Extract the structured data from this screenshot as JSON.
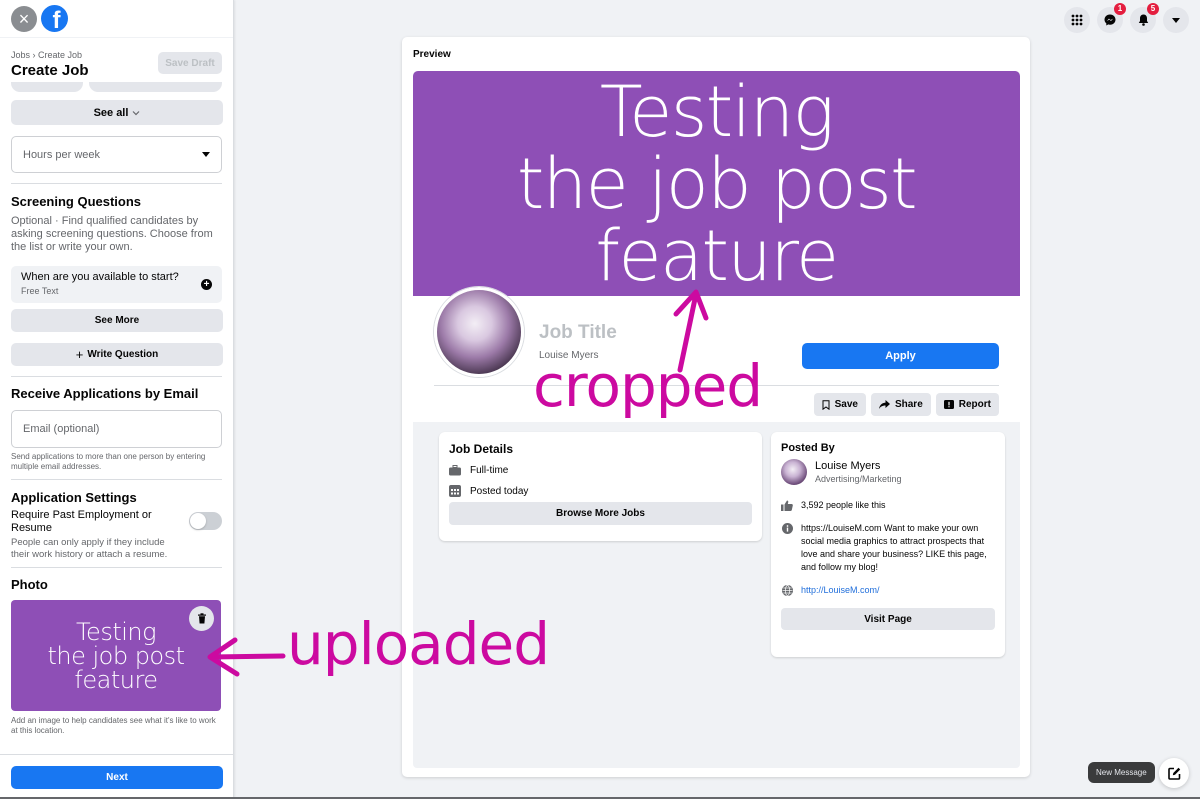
{
  "sidebar": {
    "breadcrumb": "Jobs › Create Job",
    "title": "Create Job",
    "save_draft": "Save Draft",
    "see_all": "See all",
    "hours_select": {
      "placeholder": "Hours per week"
    },
    "screening": {
      "title": "Screening Questions",
      "description": "Optional · Find qualified candidates by asking screening questions. Choose from the list or write your own.",
      "question": {
        "title": "When are you available to start?",
        "type": "Free Text"
      },
      "see_more": "See More",
      "write_question": "Write Question"
    },
    "email_section": {
      "title": "Receive Applications by Email",
      "placeholder": "Email (optional)",
      "helper": "Send applications to more than one person by entering multiple email addresses."
    },
    "app_settings": {
      "title": "Application Settings",
      "require_label": "Require Past Employment or Resume",
      "require_desc": "People can only apply if they include their work history or attach a resume.",
      "require_enabled": false
    },
    "photo": {
      "title": "Photo",
      "image_text": [
        "Testing",
        "the job post",
        "feature"
      ],
      "helper": "Add an image to help candidates see what it's like to work at this location."
    },
    "next": "Next"
  },
  "top_nav": {
    "icons": [
      "menu-grid-icon",
      "messenger-icon",
      "notifications-icon",
      "account-dropdown-icon"
    ],
    "messenger_badge": "1",
    "notifications_badge": "5"
  },
  "preview": {
    "label": "Preview",
    "cover_text": [
      "Testing",
      "the job post",
      "feature"
    ],
    "job_title": "Job Title",
    "poster": "Louise Myers",
    "apply": "Apply",
    "actions": {
      "save": "Save",
      "share": "Share",
      "report": "Report"
    },
    "job_details": {
      "title": "Job Details",
      "type": "Full-time",
      "posted": "Posted today",
      "browse": "Browse More Jobs"
    },
    "posted_by": {
      "title": "Posted By",
      "name": "Louise Myers",
      "category": "Advertising/Marketing",
      "likes": "3,592 people like this",
      "about": "https://LouiseM.com Want to make your own social media graphics to attract prospects that love and share your business? LIKE this page, and follow my blog!",
      "website": "http://LouiseM.com/",
      "visit": "Visit Page"
    }
  },
  "annotations": {
    "cropped": "cropped",
    "uploaded": "uploaded"
  },
  "messaging": {
    "new_message": "New Message"
  },
  "colors": {
    "brand_blue": "#1877f2",
    "cover_purple": "#8e4fb6",
    "annotation_magenta": "#cc0aa0"
  }
}
